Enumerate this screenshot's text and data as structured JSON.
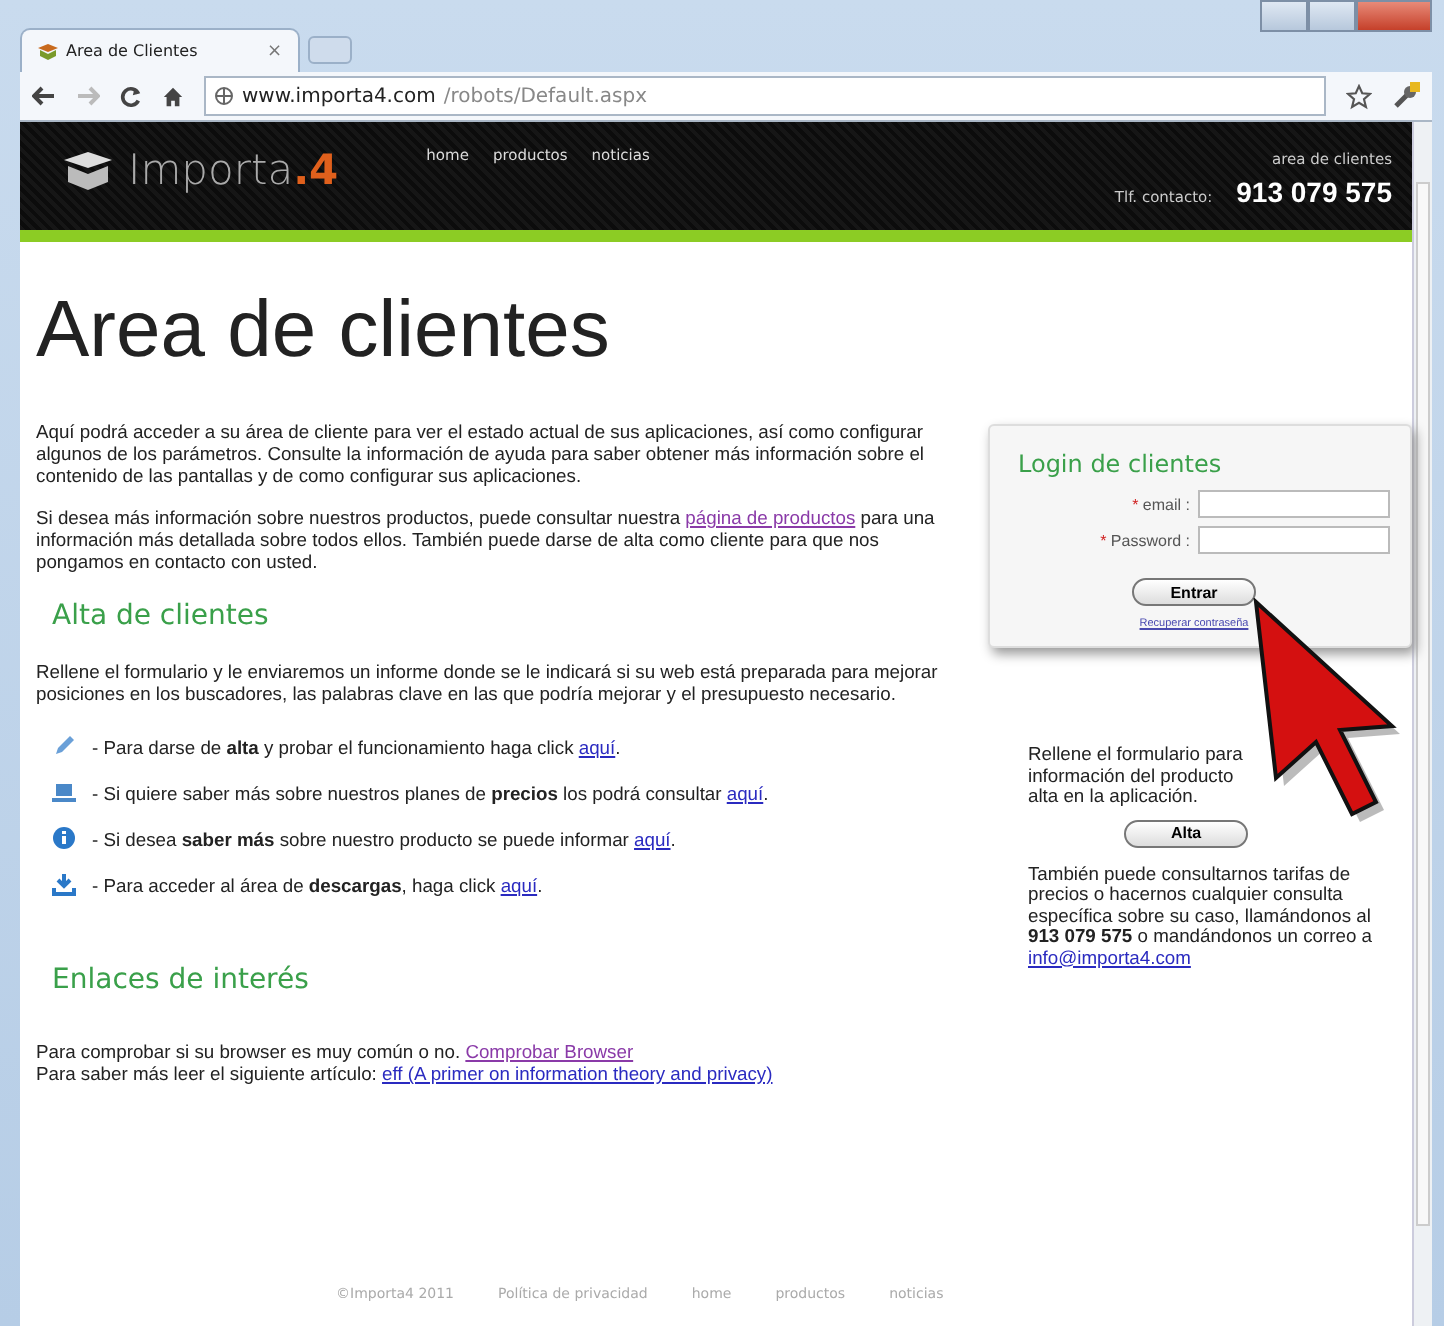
{
  "browser": {
    "tab_title": "Area de Clientes",
    "tab_close": "×",
    "url_host": "www.importa4.com",
    "url_path": "/robots/Default.aspx"
  },
  "header": {
    "logo_text": "Importa",
    "logo_accent": ".4",
    "nav": [
      "home",
      "productos",
      "noticias"
    ],
    "client_area": "area de clientes",
    "phone_label": "Tlf. contacto:",
    "phone": "913 079 575"
  },
  "page_title": "Area de clientes",
  "intro": [
    {
      "before": "Aquí podrá acceder a su área de cliente para ver el estado actual de sus aplicaciones, así como configurar algunos de los parámetros. Consulte la información de ayuda para saber obtener más información sobre el contenido de las pantallas y de como configurar sus aplicaciones."
    },
    {
      "before": "Si desea más información sobre nuestros productos, puede consultar nuestra ",
      "link": "página de productos",
      "after": " para una información más detallada sobre todos ellos. También puede darse de alta como cliente para que nos pongamos en contacto con usted."
    }
  ],
  "alta": {
    "heading": "Alta de clientes",
    "text": "Rellene el formulario y le enviaremos un informe donde se le indicará si su web está preparada para mejorar posiciones en los buscadores, las palabras clave en las que podría mejorar y el presupuesto necesario.",
    "items": [
      {
        "kind": "pencil",
        "text": "- Para darse de **alta** y probar el funcionamiento haga click ",
        "link": "aquí",
        "after": "."
      },
      {
        "kind": "laptop",
        "text": "- Si quiere saber más sobre nuestros planes de **precios** los podrá consultar ",
        "link": "aquí",
        "after": "."
      },
      {
        "kind": "info",
        "text": "- Si desea **saber más** sobre nuestro producto se puede informar ",
        "link": "aquí",
        "after": "."
      },
      {
        "kind": "download",
        "text": "- Para acceder al área de **descargas**, haga click ",
        "link": "aquí",
        "after": "."
      }
    ]
  },
  "enlaces": {
    "heading": "Enlaces de interés",
    "lines": [
      {
        "before": "Para comprobar si su browser es muy común o no. ",
        "link": "Comprobar Browser"
      },
      {
        "before": "Para saber más leer el siguiente artículo: ",
        "link": "eff (A primer on information theory and privacy)"
      }
    ]
  },
  "login": {
    "title": "Login de clientes",
    "required_mark": "*",
    "fields": [
      {
        "label": "email :"
      },
      {
        "label": "Password :"
      }
    ],
    "submit": "Entrar",
    "recover": "Recuperar contraseña"
  },
  "signup": {
    "lines": [
      "Rellene el formulario para",
      "información del producto",
      "alta en la aplicación."
    ],
    "button": "Alta",
    "contact_text": "También puede consultarnos tarifas de precios o hacernos cualquier consulta específica sobre su caso, llamándonos al **913 079 575** o mandándonos un correo a ",
    "email": "info@importa4.com"
  },
  "footer": [
    "©Importa4  2011",
    "Política de privacidad",
    "home",
    "productos",
    "noticias"
  ]
}
